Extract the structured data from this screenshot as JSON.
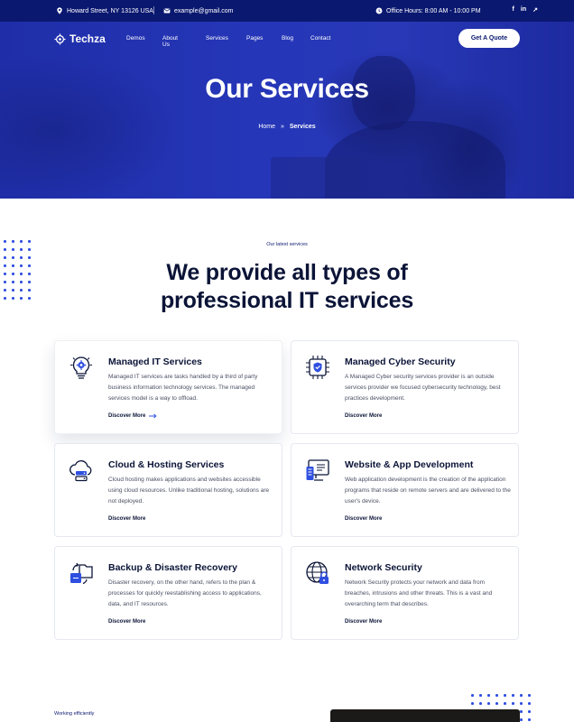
{
  "topbar": {
    "address": "Howard Street, NY 13126 USA",
    "email": "example@gmail.com",
    "hours": "Office Hours: 8:00 AM - 10:00 PM",
    "social": [
      "f",
      "in",
      "↗"
    ]
  },
  "brand": {
    "name": "Techza"
  },
  "nav": {
    "items": [
      "Demos",
      "About Us",
      "Services",
      "Pages",
      "Blog",
      "Contact"
    ],
    "cta": "Get A Quote"
  },
  "hero": {
    "title": "Our Services",
    "breadcrumb": {
      "home": "Home",
      "separator": "»",
      "current": "Services"
    }
  },
  "section": {
    "eyebrow": "Our latest services",
    "headline_line1": "We provide all types of",
    "headline_line2": "professional IT services"
  },
  "services": [
    {
      "title": "Managed IT Services",
      "desc": "Managed IT services are tasks handled by a third of party business information technology services. The managed services model is a way to offload.",
      "more": "Discover More",
      "icon": "gear-bulb-icon"
    },
    {
      "title": "Managed Cyber Security",
      "desc": "A Managed Cyber security services provider is an outside services provider we focused cybersecurity technology, best practices development.",
      "more": "Discover More",
      "icon": "shield-chip-icon"
    },
    {
      "title": "Cloud & Hosting Services",
      "desc": "Cloud hosting makes applications and websites accessible using cloud resources. Unlike traditional hosting, solutions are not deployed.",
      "more": "Discover More",
      "icon": "cloud-server-icon"
    },
    {
      "title": "Website & App Development",
      "desc": "Web application development is the creation of the application programs that reside on remote servers and are delivered to the user's device.",
      "more": "Discover More",
      "icon": "monitor-icon"
    },
    {
      "title": "Backup & Disaster Recovery",
      "desc": "Disaster recovery, on the other hand, refers to the plan & processes for quickly reestablishing  access to applications, data, and IT resources.",
      "more": "Discover More",
      "icon": "backup-folder-icon"
    },
    {
      "title": "Network Security",
      "desc": "Network Security protects your network and data from breaches, intrusions and other threats. This is a vast and overarching term that describes.",
      "more": "Discover More",
      "icon": "globe-lock-icon"
    }
  ],
  "bottom": {
    "eyebrow": "Working efficiently"
  },
  "colors": {
    "primary": "#0a1870",
    "accent": "#2f4fe0",
    "hero": "#2536b8"
  }
}
